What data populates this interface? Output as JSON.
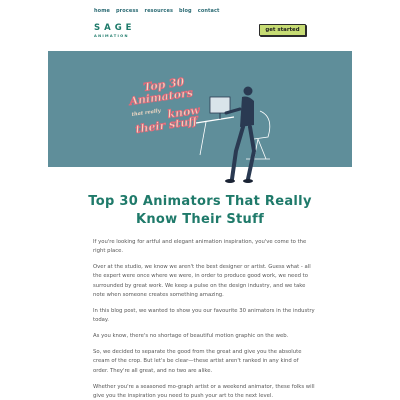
{
  "nav": {
    "items": [
      "home",
      "process",
      "resources",
      "blog",
      "contact"
    ]
  },
  "logo": {
    "word": "SAGE",
    "sub": "ANIMATION"
  },
  "cta": {
    "label": "get started"
  },
  "hero": {
    "art_lines": [
      "Top 30",
      "Animators",
      "that really",
      "know",
      "their stuff"
    ],
    "background": "#5f8e9a",
    "accent": "#e06a7a"
  },
  "article": {
    "title_line1": "Top 30 Animators That Really",
    "title_line2": "Know Their Stuff",
    "paragraphs": [
      "If you're looking for artful and elegant animation inspiration, you've come to the right place.",
      "Over at the studio, we know we aren't the best designer or artist. Guess what - all the expert were once where we were, in order to produce good work, we need to surrounded by great work. We keep a pulse on the design industry, and we take note when someone creates something amazing.",
      "In this blog post, we wanted to show you our favourite 30 animators in the industry today.",
      "As you know, there's no shortage of beautiful motion graphic on the web.",
      "So, we decided to separate the good from the great and give you the absolute cream of the crop. But let's be clear—these artist aren't ranked in any kind of order. They're all great, and no two are alike.",
      "Whether you're a seasoned mo-graph artist or a weekend animator, these folks will give you the inspiration you need to push your art to the next level."
    ]
  }
}
